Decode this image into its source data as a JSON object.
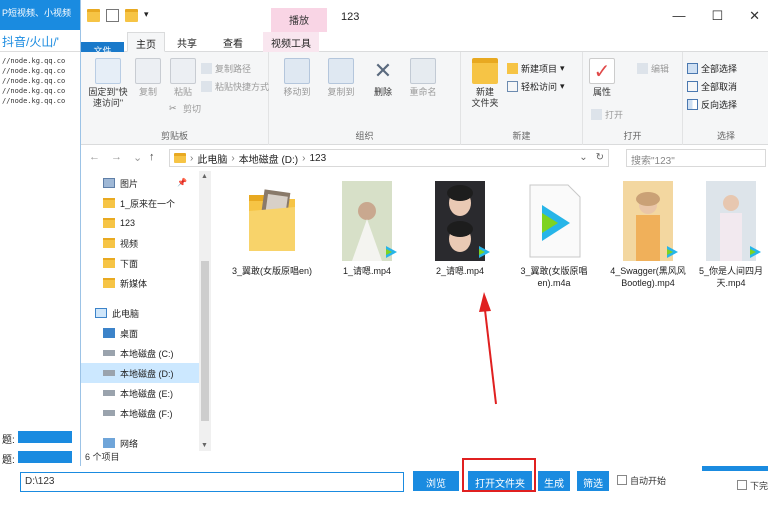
{
  "bg_app": {
    "title_fragment": "P短视频、小视频",
    "links": "抖音/火山/'",
    "urls": [
      "//node.kg.qq.co",
      "//node.kg.qq.co",
      "//node.kg.qq.co",
      "//node.kg.qq.co",
      "//node.kg.qq.co"
    ],
    "field_labels": [
      "题:",
      "题:",
      "题:"
    ]
  },
  "explorer": {
    "context_tab_top": "播放",
    "window_title": "123",
    "controls": {
      "minimize": "—",
      "maximize": "☐",
      "close": "✕"
    },
    "tabs": {
      "file": "文件",
      "home": "主页",
      "share": "共享",
      "view": "查看",
      "video_tools": "视频工具"
    },
    "ribbon": {
      "clipboard": {
        "label": "剪贴板",
        "pin": "固定到\"快速访问\"",
        "copy": "复制",
        "paste": "粘贴",
        "copy_path": "复制路径",
        "paste_shortcut": "粘贴快捷方式",
        "cut": "剪切"
      },
      "organize": {
        "label": "组织",
        "move_to": "移动到",
        "copy_to": "复制到",
        "delete": "删除",
        "rename": "重命名"
      },
      "new": {
        "label": "新建",
        "new_folder": "新建\n文件夹",
        "new_item": "新建项目",
        "easy_access": "轻松访问"
      },
      "open": {
        "label": "打开",
        "properties": "属性",
        "open": "打开",
        "edit": "编辑"
      },
      "select": {
        "label": "选择",
        "select_all": "全部选择",
        "select_none": "全部取消",
        "invert": "反向选择"
      }
    },
    "nav": {
      "back": "←",
      "forward": "→",
      "recent": "⌄",
      "up": "↑",
      "breadcrumb": [
        "此电脑",
        "本地磁盘 (D:)",
        "123"
      ],
      "search_placeholder": "搜索\"123\""
    },
    "nav_pane": [
      {
        "label": "图片",
        "icon": "picture-icon",
        "selected": false,
        "pinned": true
      },
      {
        "label": "1_原来在一个",
        "icon": "folder-icon",
        "selected": false,
        "pinned": false
      },
      {
        "label": "123",
        "icon": "folder-icon",
        "selected": false,
        "pinned": false
      },
      {
        "label": "视频",
        "icon": "folder-icon",
        "selected": false,
        "pinned": false
      },
      {
        "label": "下面",
        "icon": "folder-icon",
        "selected": false,
        "pinned": false
      },
      {
        "label": "新媒体",
        "icon": "folder-icon",
        "selected": false,
        "pinned": false
      },
      {
        "label": "此电脑",
        "icon": "computer-icon",
        "selected": false,
        "pinned": false
      },
      {
        "label": "桌面",
        "icon": "desktop-icon",
        "selected": false,
        "pinned": false
      },
      {
        "label": "本地磁盘 (C:)",
        "icon": "drive-icon",
        "selected": false,
        "pinned": false
      },
      {
        "label": "本地磁盘 (D:)",
        "icon": "drive-icon",
        "selected": true,
        "pinned": false
      },
      {
        "label": "本地磁盘 (E:)",
        "icon": "drive-icon",
        "selected": false,
        "pinned": false
      },
      {
        "label": "本地磁盘 (F:)",
        "icon": "drive-icon",
        "selected": false,
        "pinned": false
      },
      {
        "label": "网络",
        "icon": "network-icon",
        "selected": false,
        "pinned": false
      }
    ],
    "files": [
      {
        "name": "3_翼敢(女版原唱en)",
        "kind": "folder"
      },
      {
        "name": "1_请嗯.mp4",
        "kind": "video"
      },
      {
        "name": "2_请嗯.mp4",
        "kind": "video"
      },
      {
        "name": "3_翼敢(女版原唱en).m4a",
        "kind": "audio"
      },
      {
        "name": "4_Swagger(黑风风Bootleg).mp4",
        "kind": "video"
      },
      {
        "name": "5_你是人间四月天.mp4",
        "kind": "video"
      }
    ],
    "status": "6 个项目"
  },
  "bottom": {
    "path_value": "D:\\123",
    "browse": "浏览",
    "open_folder": "打开文件夹",
    "generate": "生成",
    "filter": "筛选",
    "auto_label": "自动开始",
    "download_label": "下完"
  },
  "colors": {
    "accent": "#1a8be0",
    "file_tab": "#1979ca",
    "highlight": "#e02020",
    "selected": "#cce8ff"
  }
}
